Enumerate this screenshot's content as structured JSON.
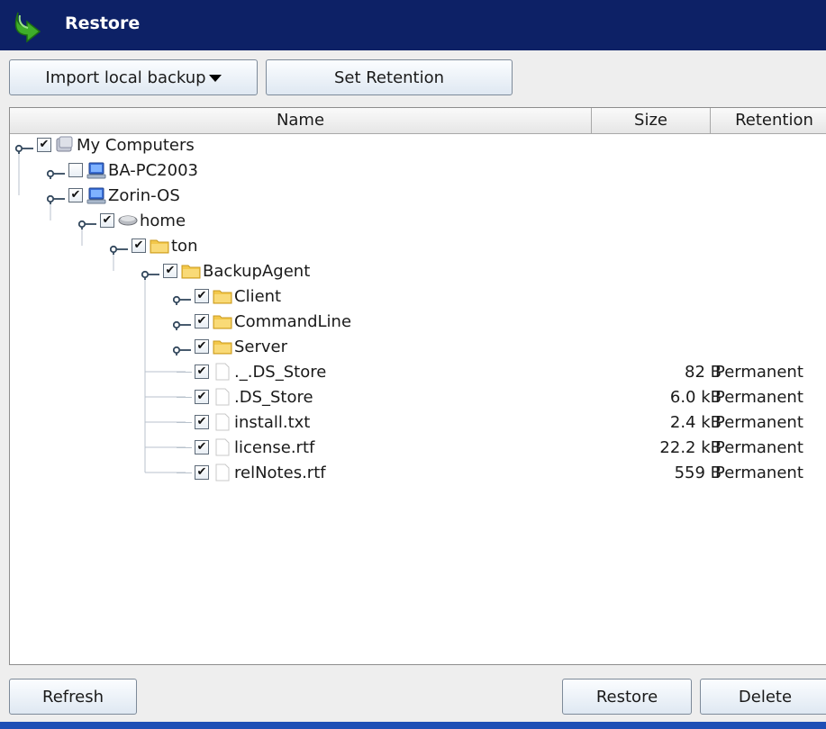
{
  "window": {
    "title": "Restore",
    "icon": "green-restore-arrow-icon",
    "title_bar_color": "#0d2166"
  },
  "toolbar": {
    "import_label": "Import local backup",
    "retention_label": "Set Retention"
  },
  "table": {
    "columns": [
      "Name",
      "Size",
      "Retention"
    ],
    "rows": [
      {
        "label": "My Computers",
        "icon": "computers-icon",
        "checked": true,
        "level": 0,
        "expander": true,
        "size": "",
        "retention": ""
      },
      {
        "label": "BA-PC2003",
        "icon": "monitor-icon",
        "checked": false,
        "level": 1,
        "expander": true,
        "size": "",
        "retention": ""
      },
      {
        "label": "Zorin-OS",
        "icon": "monitor-icon",
        "checked": true,
        "level": 1,
        "expander": true,
        "size": "",
        "retention": ""
      },
      {
        "label": "home",
        "icon": "drive-icon",
        "checked": true,
        "level": 2,
        "expander": true,
        "size": "",
        "retention": ""
      },
      {
        "label": "ton",
        "icon": "folder-icon",
        "checked": true,
        "level": 3,
        "expander": true,
        "size": "",
        "retention": ""
      },
      {
        "label": "BackupAgent",
        "icon": "folder-icon",
        "checked": true,
        "level": 4,
        "expander": true,
        "size": "",
        "retention": ""
      },
      {
        "label": "Client",
        "icon": "folder-icon",
        "checked": true,
        "level": 5,
        "expander": true,
        "size": "",
        "retention": ""
      },
      {
        "label": "CommandLine",
        "icon": "folder-icon",
        "checked": true,
        "level": 5,
        "expander": true,
        "size": "",
        "retention": ""
      },
      {
        "label": "Server",
        "icon": "folder-icon",
        "checked": true,
        "level": 5,
        "expander": true,
        "size": "",
        "retention": ""
      },
      {
        "label": "._.DS_Store",
        "icon": "file-icon",
        "checked": true,
        "level": 5,
        "expander": false,
        "size": "82 B",
        "retention": "Permanent"
      },
      {
        "label": ".DS_Store",
        "icon": "file-icon",
        "checked": true,
        "level": 5,
        "expander": false,
        "size": "6.0 kB",
        "retention": "Permanent"
      },
      {
        "label": "install.txt",
        "icon": "file-icon",
        "checked": true,
        "level": 5,
        "expander": false,
        "size": "2.4 kB",
        "retention": "Permanent"
      },
      {
        "label": "license.rtf",
        "icon": "file-icon",
        "checked": true,
        "level": 5,
        "expander": false,
        "size": "22.2 kB",
        "retention": "Permanent"
      },
      {
        "label": "relNotes.rtf",
        "icon": "file-icon",
        "checked": true,
        "level": 5,
        "expander": false,
        "size": "559 B",
        "retention": "Permanent"
      }
    ]
  },
  "footer": {
    "refresh_label": "Refresh",
    "restore_label": "Restore",
    "delete_label": "Delete"
  },
  "colors": {
    "accent": "#1e4fb5",
    "folder": "#f3c84b"
  }
}
